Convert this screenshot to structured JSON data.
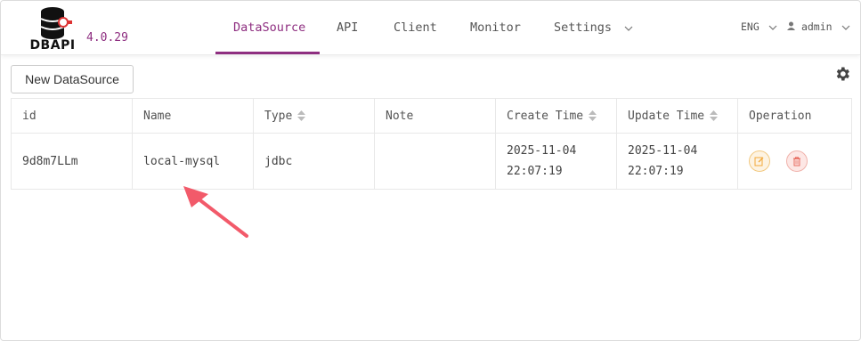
{
  "app": {
    "logo_text": "DBAPI",
    "version": "4.0.29"
  },
  "nav": {
    "items": [
      {
        "label": "DataSource",
        "active": true
      },
      {
        "label": "API",
        "active": false
      },
      {
        "label": "Client",
        "active": false
      },
      {
        "label": "Monitor",
        "active": false
      },
      {
        "label": "Settings",
        "active": false,
        "dropdown": true
      }
    ],
    "language": "ENG",
    "user": "admin"
  },
  "toolbar": {
    "new_label": "New DataSource",
    "settings_icon": "gear-icon"
  },
  "table": {
    "columns": [
      {
        "label": "id",
        "sortable": false
      },
      {
        "label": "Name",
        "sortable": false
      },
      {
        "label": "Type",
        "sortable": true
      },
      {
        "label": "Note",
        "sortable": false
      },
      {
        "label": "Create Time",
        "sortable": true
      },
      {
        "label": "Update Time",
        "sortable": true
      },
      {
        "label": "Operation",
        "sortable": false
      }
    ],
    "rows": [
      {
        "id": "9d8m7LLm",
        "name": "local-mysql",
        "type": "jdbc",
        "note": "",
        "create_date": "2025-11-04",
        "create_time": "22:07:19",
        "update_date": "2025-11-04",
        "update_time": "22:07:19",
        "ops": [
          "edit-icon",
          "delete-icon"
        ]
      }
    ]
  },
  "colors": {
    "accent": "#8e2e80",
    "annotation_arrow": "#f25a6a",
    "edit": "#f2a93b",
    "delete": "#e86b5f"
  }
}
